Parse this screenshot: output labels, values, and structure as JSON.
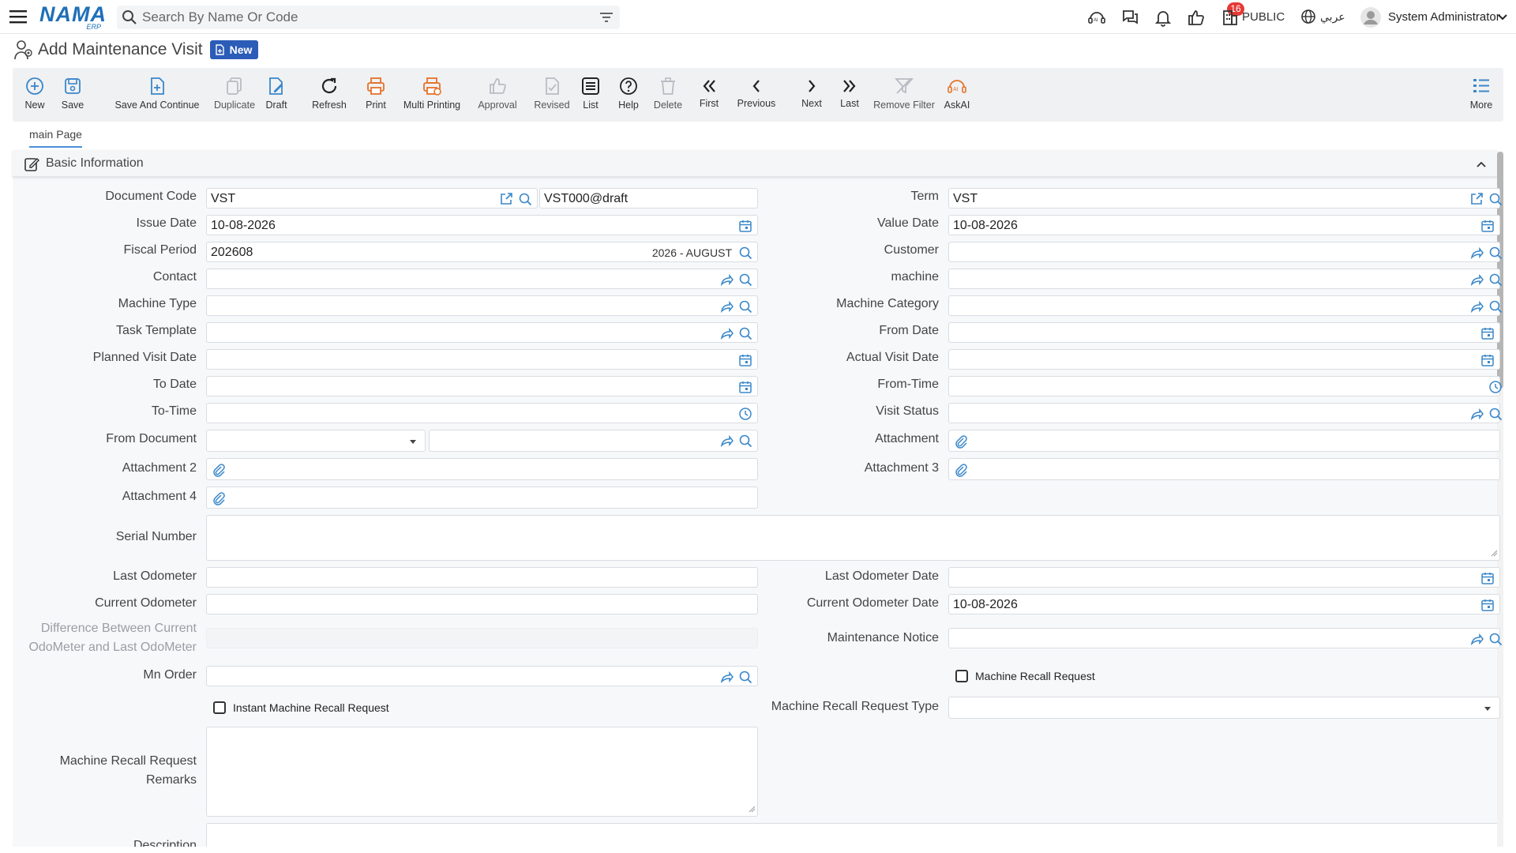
{
  "topbar": {
    "logo_text": "NAMA",
    "logo_sub": "ERP",
    "search_placeholder": "Search By Name Or Code",
    "badge_count": "16",
    "public_label": "PUBLIC",
    "lang_label": "عربي",
    "user_name": "System Administrator"
  },
  "page": {
    "title": "Add Maintenance Visit",
    "status_badge": "New"
  },
  "toolbar": {
    "new": "New",
    "save": "Save",
    "save_continue": "Save And Continue",
    "duplicate": "Duplicate",
    "draft": "Draft",
    "refresh": "Refresh",
    "print": "Print",
    "multi_printing": "Multi Printing",
    "approval": "Approval",
    "revised": "Revised",
    "list": "List",
    "help": "Help",
    "delete": "Delete",
    "first": "First",
    "previous": "Previous",
    "next": "Next",
    "last": "Last",
    "remove_filter": "Remove Filter",
    "askai": "AskAI",
    "more": "More"
  },
  "tabs": {
    "main": "main Page"
  },
  "section": {
    "title": "Basic Information"
  },
  "form": {
    "document_code": {
      "label": "Document Code",
      "value": "VST",
      "value2": "VST000@draft"
    },
    "term": {
      "label": "Term",
      "value": "VST"
    },
    "issue_date": {
      "label": "Issue Date",
      "value": "10-08-2026"
    },
    "value_date": {
      "label": "Value Date",
      "value": "10-08-2026"
    },
    "fiscal_period": {
      "label": "Fiscal Period",
      "value": "202608",
      "hint": "2026 - AUGUST"
    },
    "customer": {
      "label": "Customer",
      "value": ""
    },
    "contact": {
      "label": "Contact",
      "value": ""
    },
    "machine": {
      "label": "machine",
      "value": ""
    },
    "machine_type": {
      "label": "Machine Type",
      "value": ""
    },
    "machine_category": {
      "label": "Machine Category",
      "value": ""
    },
    "task_template": {
      "label": "Task Template",
      "value": ""
    },
    "from_date": {
      "label": "From Date",
      "value": ""
    },
    "planned_visit_date": {
      "label": "Planned Visit Date",
      "value": ""
    },
    "actual_visit_date": {
      "label": "Actual Visit Date",
      "value": ""
    },
    "to_date": {
      "label": "To Date",
      "value": ""
    },
    "from_time": {
      "label": "From-Time",
      "value": ""
    },
    "to_time": {
      "label": "To-Time",
      "value": ""
    },
    "visit_status": {
      "label": "Visit Status",
      "value": ""
    },
    "from_document": {
      "label": "From Document",
      "value": ""
    },
    "attachment": {
      "label": "Attachment"
    },
    "attachment_2": {
      "label": "Attachment 2"
    },
    "attachment_3": {
      "label": "Attachment 3"
    },
    "attachment_4": {
      "label": "Attachment 4"
    },
    "serial_number": {
      "label": "Serial Number",
      "value": ""
    },
    "last_odometer": {
      "label": "Last Odometer",
      "value": ""
    },
    "last_odometer_date": {
      "label": "Last Odometer Date",
      "value": ""
    },
    "current_odometer": {
      "label": "Current Odometer",
      "value": ""
    },
    "current_odometer_date": {
      "label": "Current Odometer Date",
      "value": "10-08-2026"
    },
    "difference_line1": "Difference Between Current",
    "difference_line2": "OdoMeter and Last OdoMeter",
    "maintenance_notice": {
      "label": "Maintenance Notice",
      "value": ""
    },
    "mn_order": {
      "label": "Mn Order",
      "value": ""
    },
    "machine_recall_request": {
      "label": "Machine Recall Request",
      "checked": false
    },
    "instant_machine_recall_request": {
      "label": "Instant Machine Recall Request",
      "checked": false
    },
    "machine_recall_request_type": {
      "label": "Machine Recall Request Type",
      "value": ""
    },
    "remarks_line1": "Machine Recall Request",
    "remarks_line2": "Remarks",
    "description": {
      "label": "Description"
    }
  },
  "colors": {
    "accent": "#2b5cb8",
    "logo": "#1e6fb8",
    "icon_blue": "#3a87c9",
    "icon_orange": "#e5722a",
    "badge_red": "#e53935"
  }
}
